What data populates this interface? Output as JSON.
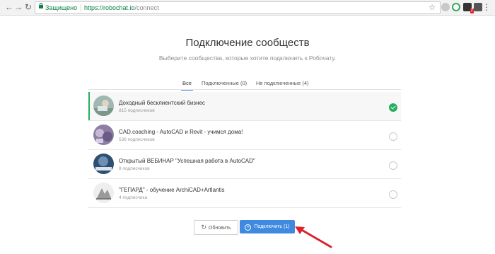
{
  "browser": {
    "secure_label": "Защищено",
    "url_host": "https://robochat.io",
    "url_path": "/connect",
    "ext_badge": "2"
  },
  "page": {
    "title": "Подключение сообществ",
    "subtitle": "Выберите сообщества, которые хотите подключить к Робочату."
  },
  "tabs": [
    {
      "label": "Все",
      "active": true
    },
    {
      "label": "Подключенные (0)",
      "active": false
    },
    {
      "label": "Не подключенные (4)",
      "active": false
    }
  ],
  "communities": [
    {
      "name": "Доходный бесклиентский бизнес",
      "count": "815 подписчиков",
      "selected": true
    },
    {
      "name": "CAD.coaching - AutoCAD и Revit - учимся дома!",
      "count": "536 подписчиков",
      "selected": false
    },
    {
      "name": "Открытый ВЕБИНАР \"Успешная работа в AutoCAD\"",
      "count": "9 подписчиков",
      "selected": false
    },
    {
      "name": "\"ГЕПАРД\" - обучение ArchiCAD+Artlantis",
      "count": "4 подписчика",
      "selected": false
    }
  ],
  "buttons": {
    "refresh": "Обновить",
    "connect": "Подключить (1)"
  },
  "colors": {
    "accent": "#3f8ae0",
    "selected_check": "#27ae60",
    "annotation_arrow": "#d9232e"
  }
}
